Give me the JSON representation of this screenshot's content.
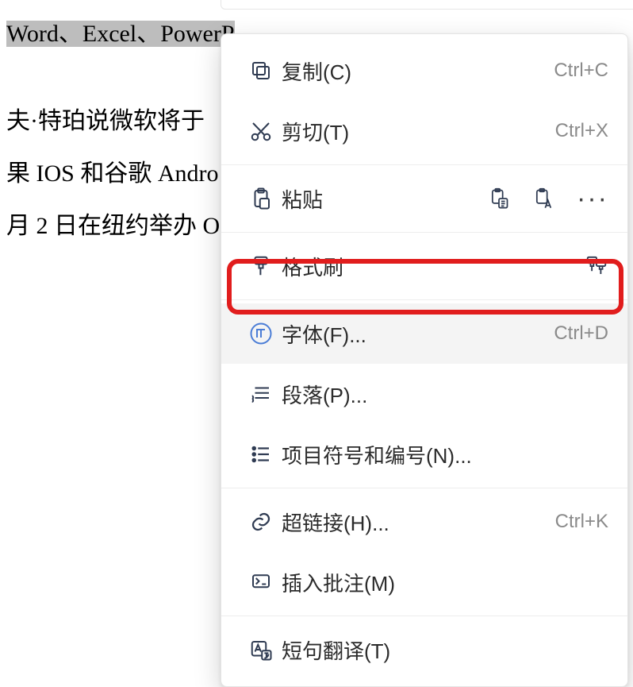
{
  "doc_lines": {
    "l1": "Word、Excel、PowerP",
    "l2": "夫·特珀说微软将于",
    "l3": "果 IOS 和谷歌 Andro",
    "l4": "月 2 日在纽约举办 O"
  },
  "menu": {
    "copy": {
      "label": "复制(C)",
      "shortcut": "Ctrl+C"
    },
    "cut": {
      "label": "剪切(T)",
      "shortcut": "Ctrl+X"
    },
    "paste": {
      "label": "粘贴"
    },
    "format_paint": {
      "label": "格式刷"
    },
    "font": {
      "label": "字体(F)...",
      "shortcut": "Ctrl+D"
    },
    "paragraph": {
      "label": "段落(P)..."
    },
    "bullets": {
      "label": "项目符号和编号(N)..."
    },
    "hyperlink": {
      "label": "超链接(H)...",
      "shortcut": "Ctrl+K"
    },
    "comment": {
      "label": "插入批注(M)"
    },
    "translate": {
      "label": "短句翻译(T)"
    }
  }
}
